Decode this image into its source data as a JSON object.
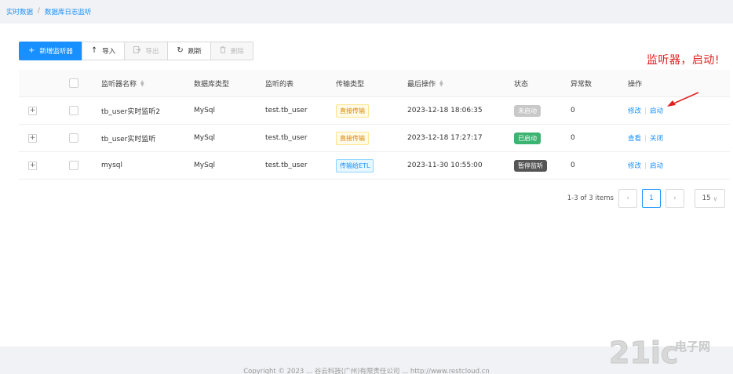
{
  "breadcrumb": {
    "root": "实时数据",
    "separator": "/",
    "current": "数据库日志监听"
  },
  "toolbar": {
    "add_label": "新增监听器",
    "import_label": "导入",
    "export_label": "导出",
    "refresh_label": "刷新",
    "delete_label": "删除"
  },
  "annotation": "监听器，启动!",
  "table": {
    "headers": {
      "name": "监听器名称",
      "db_type": "数据库类型",
      "table": "监听的表",
      "transfer": "传输类型",
      "last_op": "最后操作",
      "status": "状态",
      "errors": "异常数",
      "ops": "操作"
    },
    "rows": [
      {
        "expand": "+",
        "name": "tb_user实时监听2",
        "db_type": "MySql",
        "table": "test.tb_user",
        "transfer": "直接传输",
        "last_op": "2023-12-18 18:06:35",
        "status": "未启动",
        "errors": "0",
        "op1": "修改",
        "op2": "启动"
      },
      {
        "expand": "+",
        "name": "tb_user实时监听",
        "db_type": "MySql",
        "table": "test.tb_user",
        "transfer": "直接传输",
        "last_op": "2023-12-18 17:27:17",
        "status": "已启动",
        "errors": "0",
        "op1": "查看",
        "op2": "关闭"
      },
      {
        "expand": "+",
        "name": "mysql",
        "db_type": "MySql",
        "table": "test.tb_user",
        "transfer": "传输给ETL",
        "last_op": "2023-11-30 10:55:00",
        "status": "暂停监听",
        "errors": "0",
        "op1": "修改",
        "op2": "启动"
      }
    ]
  },
  "pagination": {
    "summary": "1-3 of 3 items",
    "page": "1",
    "page_size": "15"
  },
  "footer": "Copyright © 2023 ... 谷云科技(广州)有限责任公司 ... http://www.restcloud.cn",
  "watermark": {
    "brand": "21ic",
    "cn": "电子网"
  },
  "colors": {
    "primary": "#1890ff",
    "annotation": "#e02020",
    "status_running": "#3cb371",
    "status_paused": "#555555",
    "status_stopped": "#c8c8c8"
  }
}
